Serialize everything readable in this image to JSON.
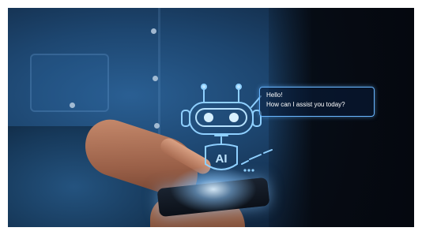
{
  "chat": {
    "greeting": "Hello!",
    "question": "How can I assist you today?"
  },
  "robot": {
    "label": "AI"
  },
  "colors": {
    "hologram": "#7cc4ff",
    "shirt": "#1e4a76",
    "background": "#05080f"
  }
}
